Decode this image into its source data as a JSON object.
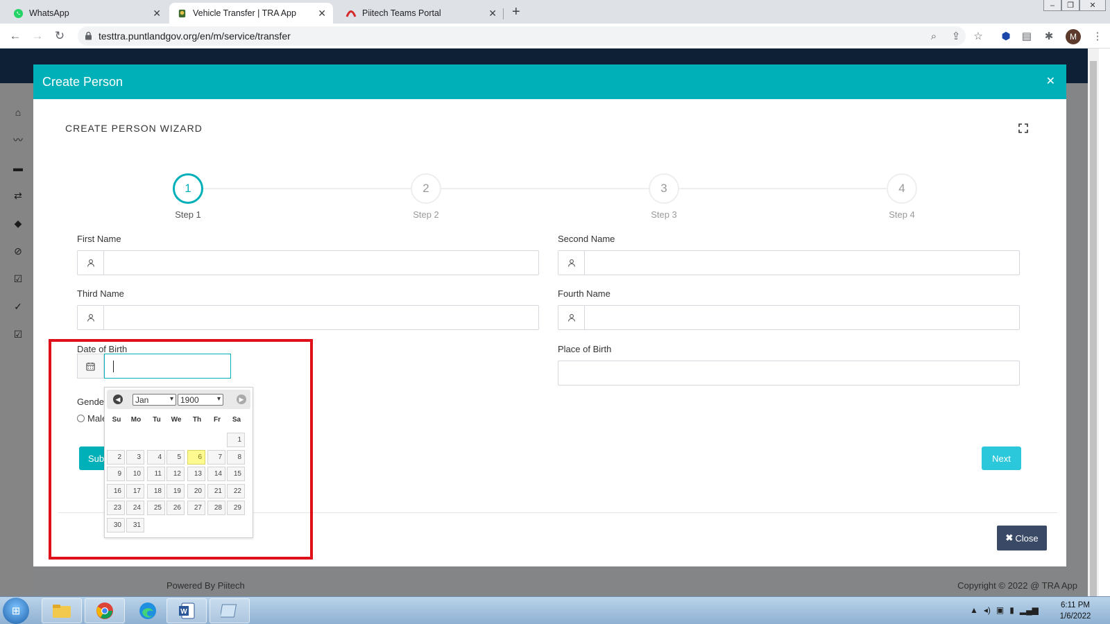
{
  "browser": {
    "tabs": [
      {
        "title": "WhatsApp"
      },
      {
        "title": "Vehicle Transfer | TRA App"
      },
      {
        "title": "Piitech Teams Portal"
      }
    ],
    "url": "testtra.puntlandgov.org/en/m/service/transfer",
    "profile_initial": "M"
  },
  "modal": {
    "title": "Create Person",
    "wizard_title": "CREATE PERSON WIZARD",
    "steps": [
      {
        "number": "1",
        "label": "Step 1"
      },
      {
        "number": "2",
        "label": "Step 2"
      },
      {
        "number": "3",
        "label": "Step 3"
      },
      {
        "number": "4",
        "label": "Step 4"
      }
    ],
    "fields": {
      "first_name": "First Name",
      "second_name": "Second Name",
      "third_name": "Third Name",
      "fourth_name": "Fourth Name",
      "date_of_birth": "Date of Birth",
      "place_of_birth": "Place of Birth",
      "gender": "Gende",
      "male": "Male"
    },
    "submit_label": "Sub",
    "next_label": "Next",
    "close_label": "Close"
  },
  "datepicker": {
    "month": "Jan",
    "year": "1900",
    "weekdays": [
      "Su",
      "Mo",
      "Tu",
      "We",
      "Th",
      "Fr",
      "Sa"
    ],
    "highlighted_day": 6,
    "first_weekday_index": 6,
    "days_in_month": 31
  },
  "footer": {
    "powered": "Powered By Piitech",
    "copyright": "Copyright © 2022 @ TRA App"
  },
  "taskbar": {
    "time": "6:11 PM",
    "date": "1/6/2022"
  },
  "colors": {
    "accent": "#00b0b9",
    "next_button": "#2bc8dc",
    "close_button": "#3a4a66",
    "highlight_box": "#e0101a"
  }
}
